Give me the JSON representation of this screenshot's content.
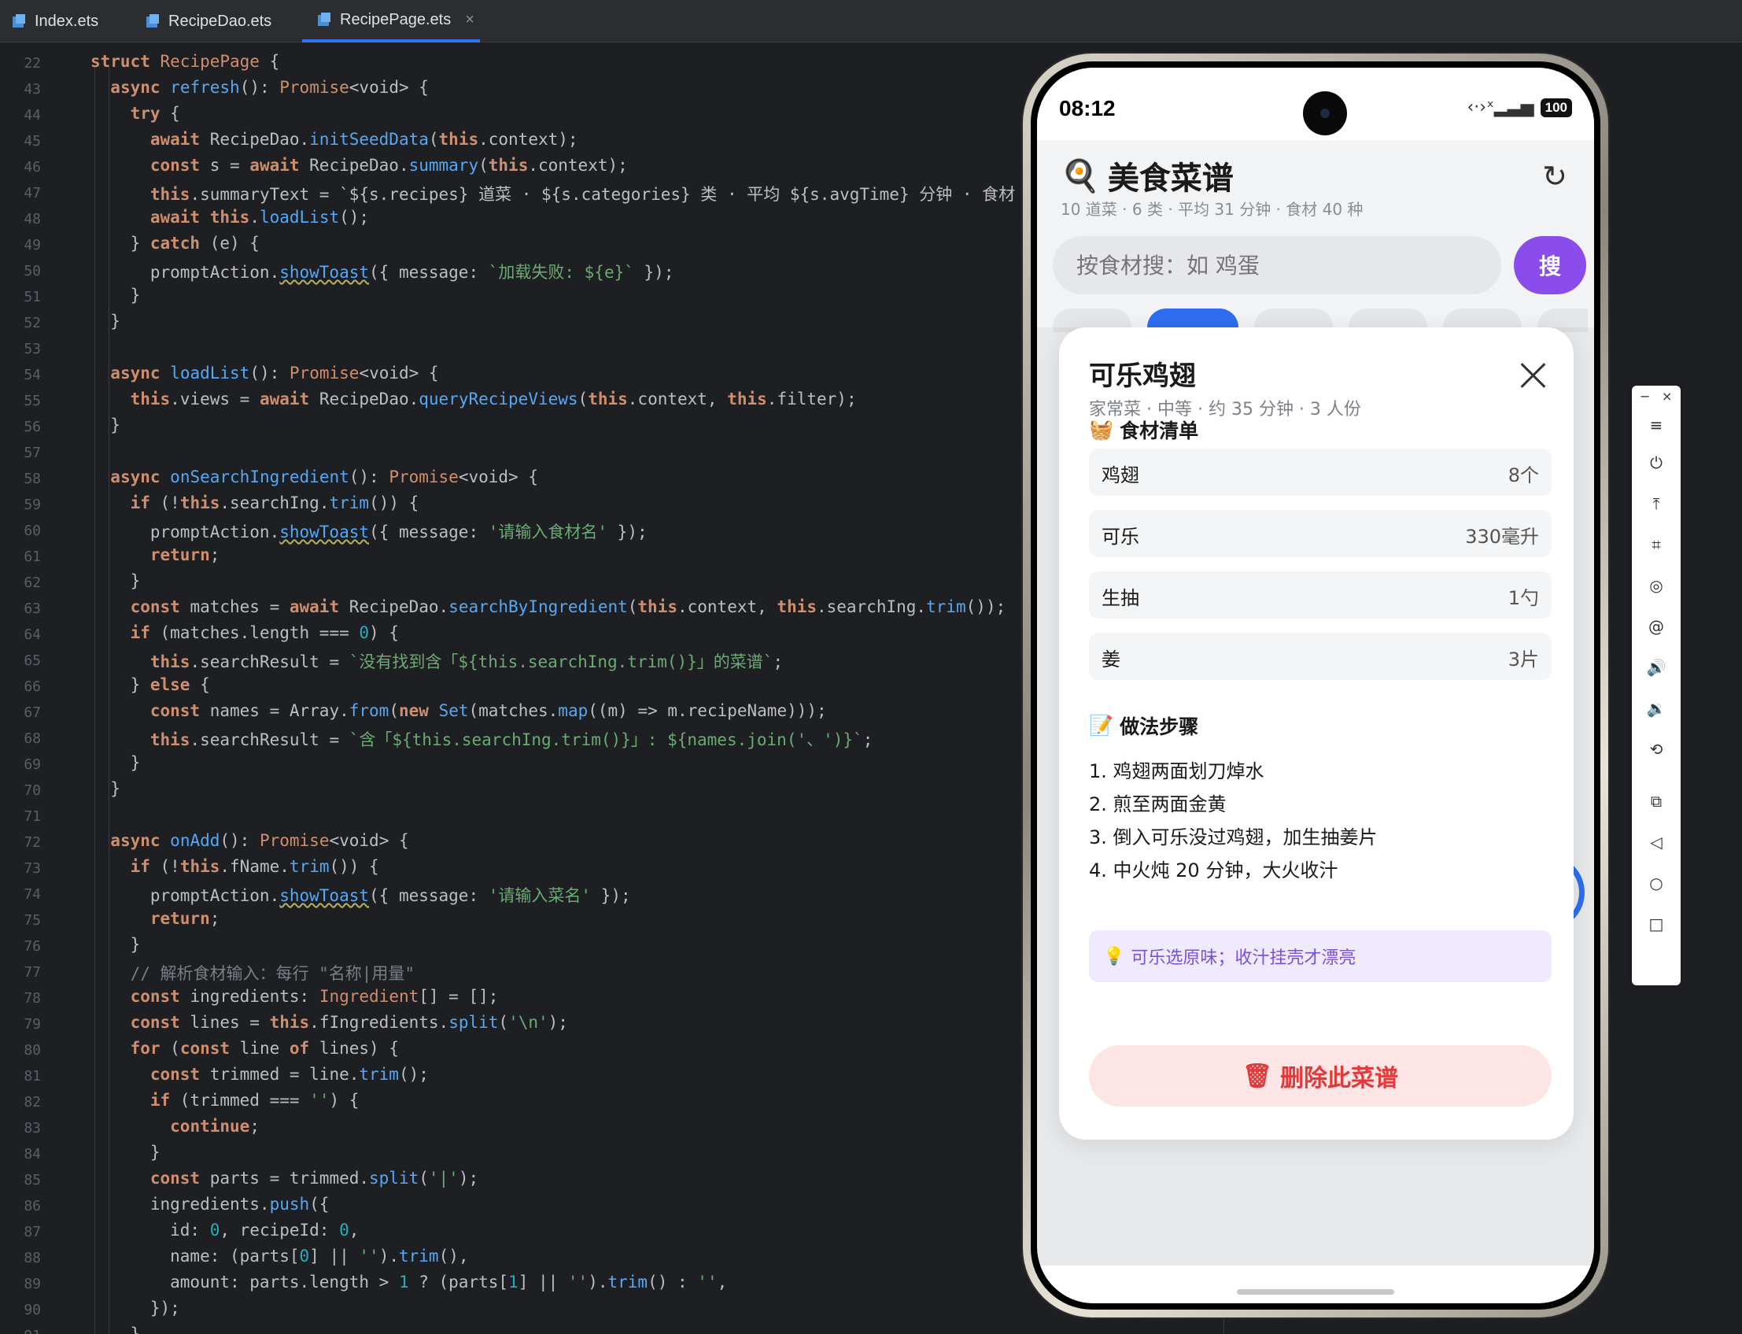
{
  "tabs": [
    {
      "label": "Index.ets",
      "active": false
    },
    {
      "label": "RecipeDao.ets",
      "active": false
    },
    {
      "label": "RecipePage.ets",
      "active": true,
      "close": "×"
    }
  ],
  "line_numbers": [
    "22",
    "43",
    "44",
    "45",
    "46",
    "47",
    "48",
    "49",
    "50",
    "51",
    "52",
    "53",
    "54",
    "55",
    "56",
    "57",
    "58",
    "59",
    "60",
    "61",
    "62",
    "63",
    "64",
    "65",
    "66",
    "67",
    "68",
    "69",
    "70",
    "71",
    "72",
    "73",
    "74",
    "75",
    "76",
    "77",
    "78",
    "79",
    "80",
    "81",
    "82",
    "83",
    "84",
    "85",
    "86",
    "87",
    "88",
    "89",
    "90",
    "91"
  ],
  "code_lines": [
    "struct RecipePage {",
    "  async refresh(): Promise<void> {",
    "    try {",
    "      await RecipeDao.initSeedData(this.context);",
    "      const s = await RecipeDao.summary(this.context);",
    "      this.summaryText = `${s.recipes} 道菜 · ${s.categories} 类 · 平均 ${s.avgTime} 分钟 · 食材 ${s.in",
    "      await this.loadList();",
    "    } catch (e) {",
    "      promptAction.showToast({ message: `加载失败: ${e}` });",
    "    }",
    "  }",
    "",
    "  async loadList(): Promise<void> {",
    "    this.views = await RecipeDao.queryRecipeViews(this.context, this.filter);",
    "  }",
    "",
    "  async onSearchIngredient(): Promise<void> {",
    "    if (!this.searchIng.trim()) {",
    "      promptAction.showToast({ message: '请输入食材名' });",
    "      return;",
    "    }",
    "    const matches = await RecipeDao.searchByIngredient(this.context, this.searchIng.trim());",
    "    if (matches.length === 0) {",
    "      this.searchResult = `没有找到含「${this.searchIng.trim()}」的菜谱`;",
    "    } else {",
    "      const names = Array.from(new Set(matches.map((m) => m.recipeName)));",
    "      this.searchResult = `含「${this.searchIng.trim()}」: ${names.join('、')}`;",
    "    }",
    "  }",
    "",
    "  async onAdd(): Promise<void> {",
    "    if (!this.fName.trim()) {",
    "      promptAction.showToast({ message: '请输入菜名' });",
    "      return;",
    "    }",
    "    // 解析食材输入：每行 \"名称|用量\"",
    "    const ingredients: Ingredient[] = [];",
    "    const lines = this.fIngredients.split('\\n');",
    "    for (const line of lines) {",
    "      const trimmed = line.trim();",
    "      if (trimmed === '') {",
    "        continue;",
    "      }",
    "      const parts = trimmed.split('|');",
    "      ingredients.push({",
    "        id: 0, recipeId: 0,",
    "        name: (parts[0] || '').trim(),",
    "        amount: parts.length > 1 ? (parts[1] || '').trim() : '',",
    "      });",
    "    }"
  ],
  "phone": {
    "time": "08:12",
    "status_icons": "‹·›ˣ▂▃▅",
    "battery": "100",
    "app_icon": "🍳",
    "app_title": "美食菜谱",
    "summary": "10 道菜 · 6 类 · 平均 31 分钟 · 食材 40 种",
    "refresh_icon": "↻",
    "search_placeholder": "按食材搜：如 鸡蛋",
    "search_button": "搜",
    "sheet": {
      "dish_name": "可乐鸡翅",
      "dish_meta": "家常菜 · 中等 · 约 35 分钟 · 3 人份",
      "ingredients_icon": "🧺",
      "ingredients_title": "食材清单",
      "ingredients": [
        {
          "name": "鸡翅",
          "amount": "8个"
        },
        {
          "name": "可乐",
          "amount": "330毫升"
        },
        {
          "name": "生抽",
          "amount": "1勺"
        },
        {
          "name": "姜",
          "amount": "3片"
        }
      ],
      "steps_icon": "📝",
      "steps_title": "做法步骤",
      "steps": [
        "1. 鸡翅两面划刀焯水",
        "2. 煎至两面金黄",
        "3. 倒入可乐没过鸡翅，加生抽姜片",
        "4. 中火炖 20 分钟，大火收汁"
      ],
      "tip_icon": "💡",
      "tip": "可乐选原味；收汁挂壳才漂亮",
      "delete_icon": "🗑",
      "delete_label": "删除此菜谱"
    }
  },
  "emulator_toolbar": {
    "minimize": "−",
    "close": "×",
    "buttons": [
      "≡",
      "⏻",
      "⤒",
      "⌗",
      "◎",
      "@",
      "🔊",
      "🔉",
      "⟲",
      "⧉",
      "◁",
      "○",
      "□"
    ]
  }
}
